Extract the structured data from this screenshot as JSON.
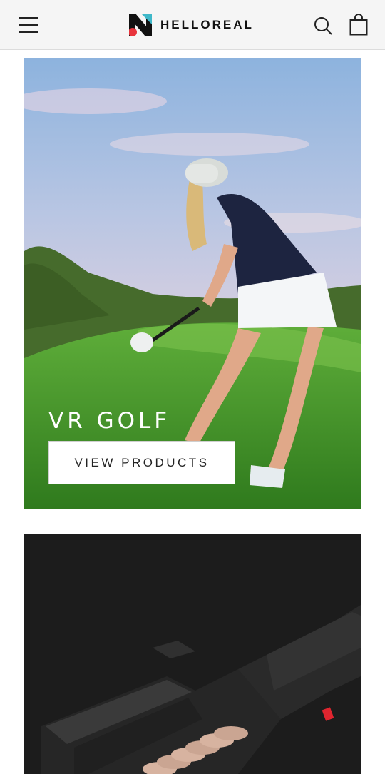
{
  "header": {
    "brand": "HELLOREAL",
    "icons": [
      "menu-icon",
      "search-icon",
      "cart-icon"
    ],
    "logo_colors": {
      "dark": "#111111",
      "teal": "#3fb8c9",
      "red": "#e8343c"
    }
  },
  "cards": [
    {
      "title": "VR GOLF",
      "cta_label": "VIEW PRODUCTS"
    },
    {
      "title": "",
      "cta_label": ""
    }
  ]
}
